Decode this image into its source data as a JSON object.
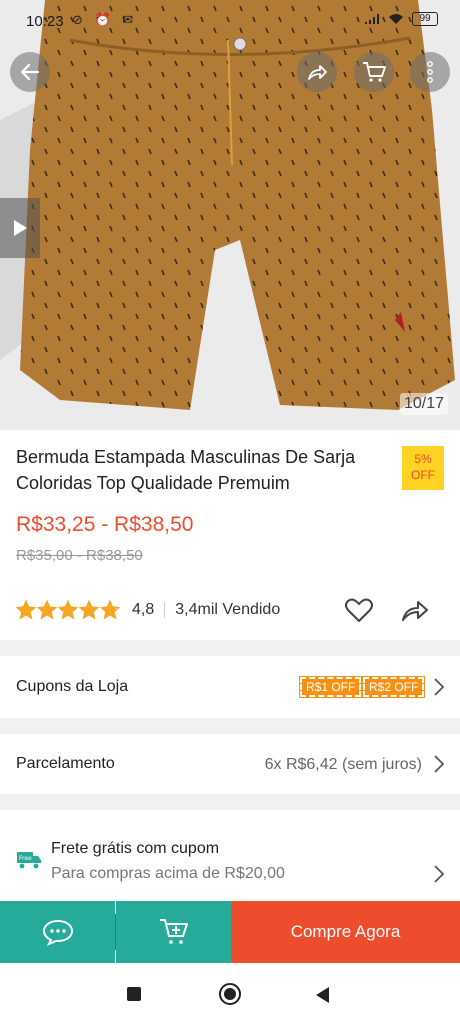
{
  "status_bar": {
    "time": "10:23",
    "left_icons": "⊘ ⏰ ✉",
    "battery": "99"
  },
  "product_image": {
    "counter": "10/17",
    "icons": [
      "back-arrow-icon",
      "share-icon",
      "cart-icon",
      "more-vertical-icon",
      "play-icon"
    ]
  },
  "product": {
    "title": "Bermuda Estampada Masculinas De Sarja Coloridas Top Qualidade Premuim",
    "discount_percent": "5%",
    "discount_off": "OFF",
    "price_range": "R$33,25 - R$38,50",
    "old_price_range": "R$35,00 - R$38,50",
    "rating": "4,8",
    "rating_stars": 4.8,
    "sold": "3,4mil Vendido"
  },
  "coupons_row": {
    "label": "Cupons da Loja",
    "coupons": [
      "R$1 OFF",
      "R$2 OFF"
    ]
  },
  "installment_row": {
    "label": "Parcelamento",
    "value": "6x R$6,42 (sem juros)"
  },
  "shipping_row": {
    "icon_label": "Free",
    "title": "Frete grátis com cupom",
    "subtitle": "Para compras acima de R$20,00"
  },
  "bottom_bar": {
    "buy_label": "Compre Agora"
  },
  "colors": {
    "brand": "#ee4d2d",
    "teal": "#26aa99",
    "star": "#f5a623",
    "badge": "#ffd323",
    "coupon": "#f69113"
  }
}
